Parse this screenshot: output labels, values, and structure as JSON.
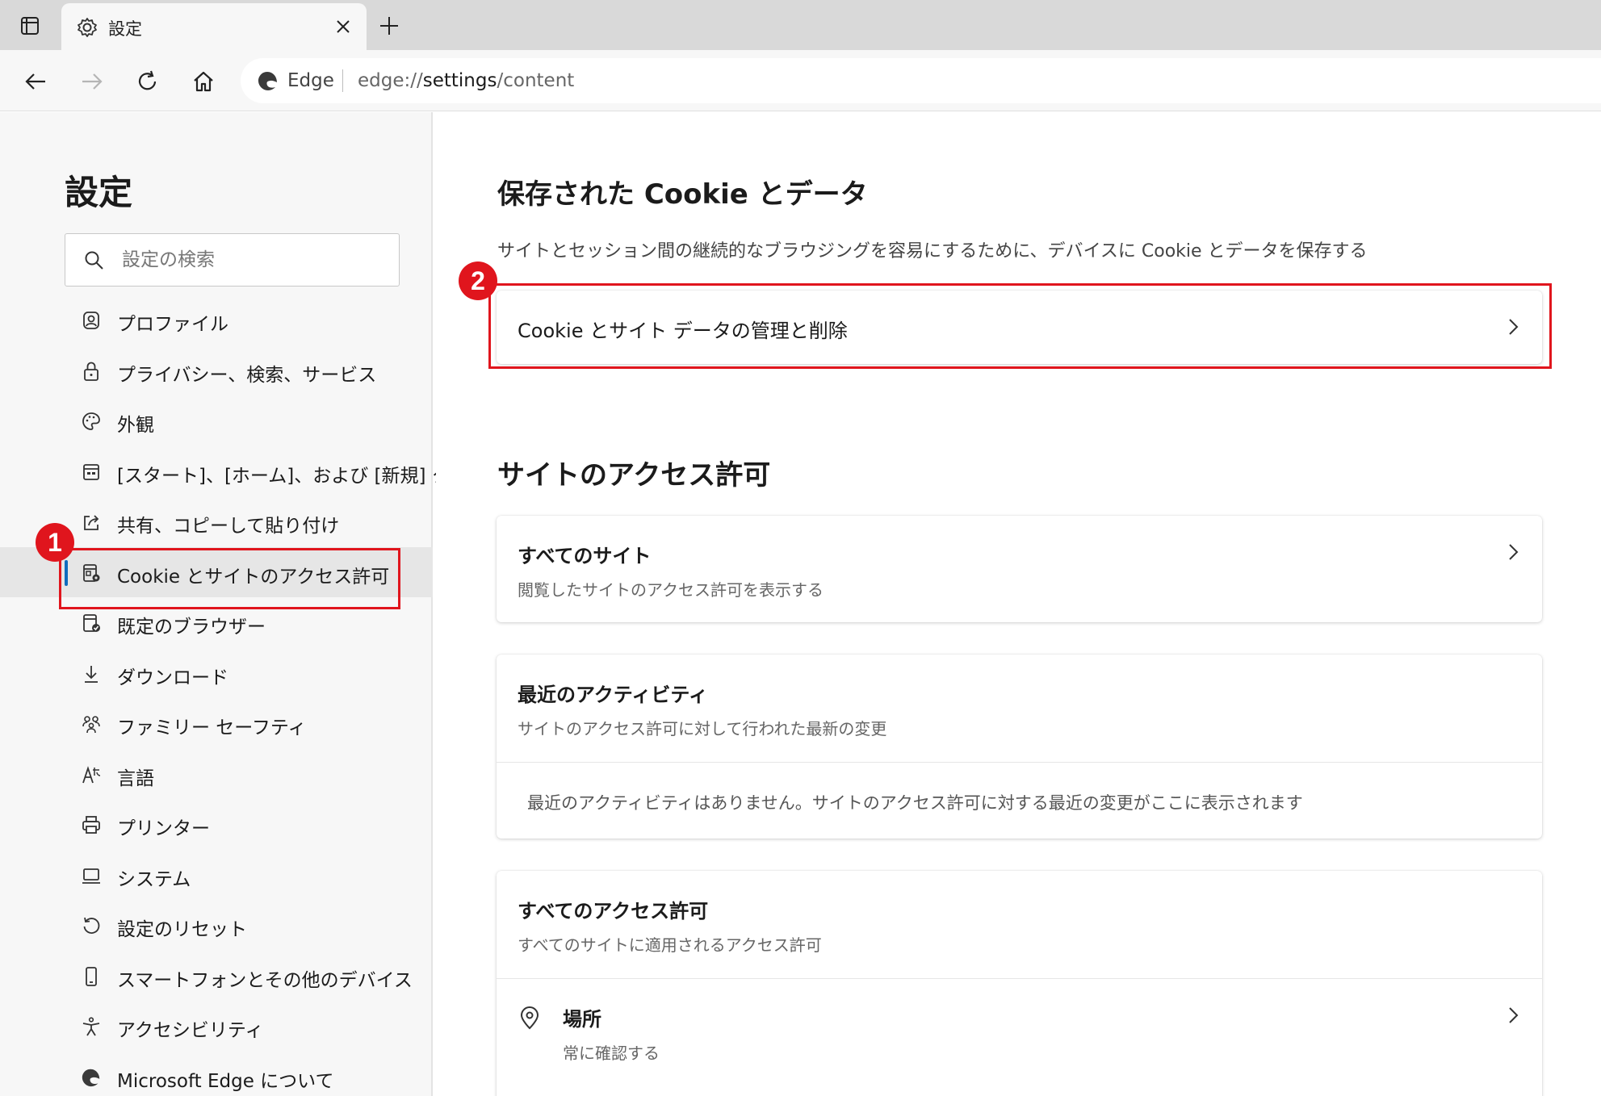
{
  "tab": {
    "title": "設定"
  },
  "address_bar": {
    "site_name": "Edge",
    "url_prefix": "edge://",
    "url_bold": "settings",
    "url_suffix": "/content"
  },
  "sidebar": {
    "title": "設定",
    "search_placeholder": "設定の検索",
    "items": [
      {
        "label": "プロファイル",
        "icon": "profile-icon"
      },
      {
        "label": "プライバシー、検索、サービス",
        "icon": "lock-icon"
      },
      {
        "label": "外観",
        "icon": "palette-icon"
      },
      {
        "label": "[スタート]、[ホーム]、および [新規] タブ",
        "icon": "start-home-icon"
      },
      {
        "label": "共有、コピーして貼り付け",
        "icon": "share-icon"
      },
      {
        "label": "Cookie とサイトのアクセス許可",
        "icon": "cookie-permissions-icon",
        "active": true
      },
      {
        "label": "既定のブラウザー",
        "icon": "default-browser-icon"
      },
      {
        "label": "ダウンロード",
        "icon": "download-icon"
      },
      {
        "label": "ファミリー セーフティ",
        "icon": "family-icon"
      },
      {
        "label": "言語",
        "icon": "language-icon"
      },
      {
        "label": "プリンター",
        "icon": "printer-icon"
      },
      {
        "label": "システム",
        "icon": "system-icon"
      },
      {
        "label": "設定のリセット",
        "icon": "reset-icon"
      },
      {
        "label": "スマートフォンとその他のデバイス",
        "icon": "phone-icon"
      },
      {
        "label": "アクセシビリティ",
        "icon": "accessibility-icon"
      },
      {
        "label": "Microsoft Edge について",
        "icon": "edge-logo-icon"
      }
    ]
  },
  "main": {
    "cookies_section": {
      "title": "保存された Cookie とデータ",
      "description": "サイトとセッション間の継続的なブラウジングを容易にするために、デバイスに Cookie とデータを保存する",
      "manage_label": "Cookie とサイト データの管理と削除"
    },
    "permissions_section": {
      "title": "サイトのアクセス許可",
      "all_sites": {
        "title": "すべてのサイト",
        "subtitle": "閲覧したサイトのアクセス許可を表示する"
      },
      "recent_activity": {
        "title": "最近のアクティビティ",
        "subtitle": "サイトのアクセス許可に対して行われた最新の変更",
        "empty_text": "最近のアクティビティはありません。サイトのアクセス許可に対する最近の変更がここに表示されます"
      },
      "all_permissions": {
        "title": "すべてのアクセス許可",
        "subtitle": "すべてのサイトに適用されるアクセス許可"
      },
      "location": {
        "title": "場所",
        "subtitle": "常に確認する"
      }
    }
  },
  "annotations": {
    "badge1": "1",
    "badge2": "2",
    "highlight_color": "#e0151d"
  },
  "colors": {
    "accent": "#0f6cbd",
    "sidebar_bg": "#f7f7f7",
    "tabstrip_bg": "#d9d9d9"
  }
}
